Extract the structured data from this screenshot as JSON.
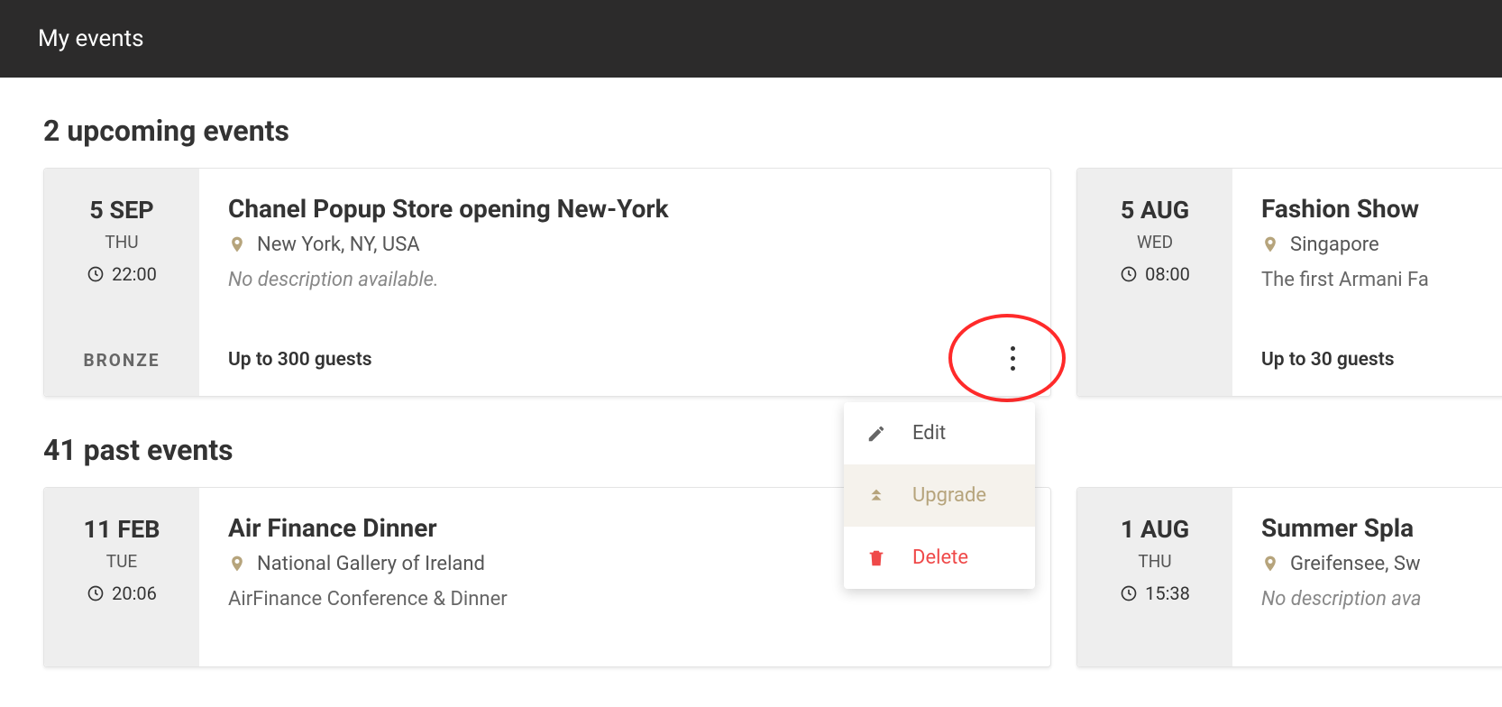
{
  "header": {
    "title": "My events"
  },
  "sections": {
    "upcoming": {
      "title": "2 upcoming events"
    },
    "past": {
      "title": "41 past events"
    }
  },
  "colors": {
    "accent": "#b6a47c",
    "danger": "#ef4949",
    "annotation": "#ff2a2a"
  },
  "menu": {
    "edit": "Edit",
    "upgrade": "Upgrade",
    "delete": "Delete"
  },
  "events": {
    "upcoming": [
      {
        "date": "5 SEP",
        "dow": "THU",
        "time": "22:00",
        "tier": "BRONZE",
        "title": "Chanel Popup Store opening New-York",
        "location": "New York, NY, USA",
        "description": "No description available.",
        "description_is_placeholder": true,
        "guests": "Up to 300 guests"
      },
      {
        "date": "5 AUG",
        "dow": "WED",
        "time": "08:00",
        "title": "Fashion Show",
        "location": "Singapore",
        "description": "The first Armani Fa",
        "description_is_placeholder": false,
        "guests": "Up to 30 guests"
      }
    ],
    "past": [
      {
        "date": "11 FEB",
        "dow": "TUE",
        "time": "20:06",
        "title": "Air Finance Dinner",
        "location": "National Gallery of Ireland",
        "description": "AirFinance Conference & Dinner",
        "description_is_placeholder": false
      },
      {
        "date": "1 AUG",
        "dow": "THU",
        "time": "15:38",
        "title": "Summer Spla",
        "location": "Greifensee, Sw",
        "description": "No description ava",
        "description_is_placeholder": true
      }
    ]
  }
}
